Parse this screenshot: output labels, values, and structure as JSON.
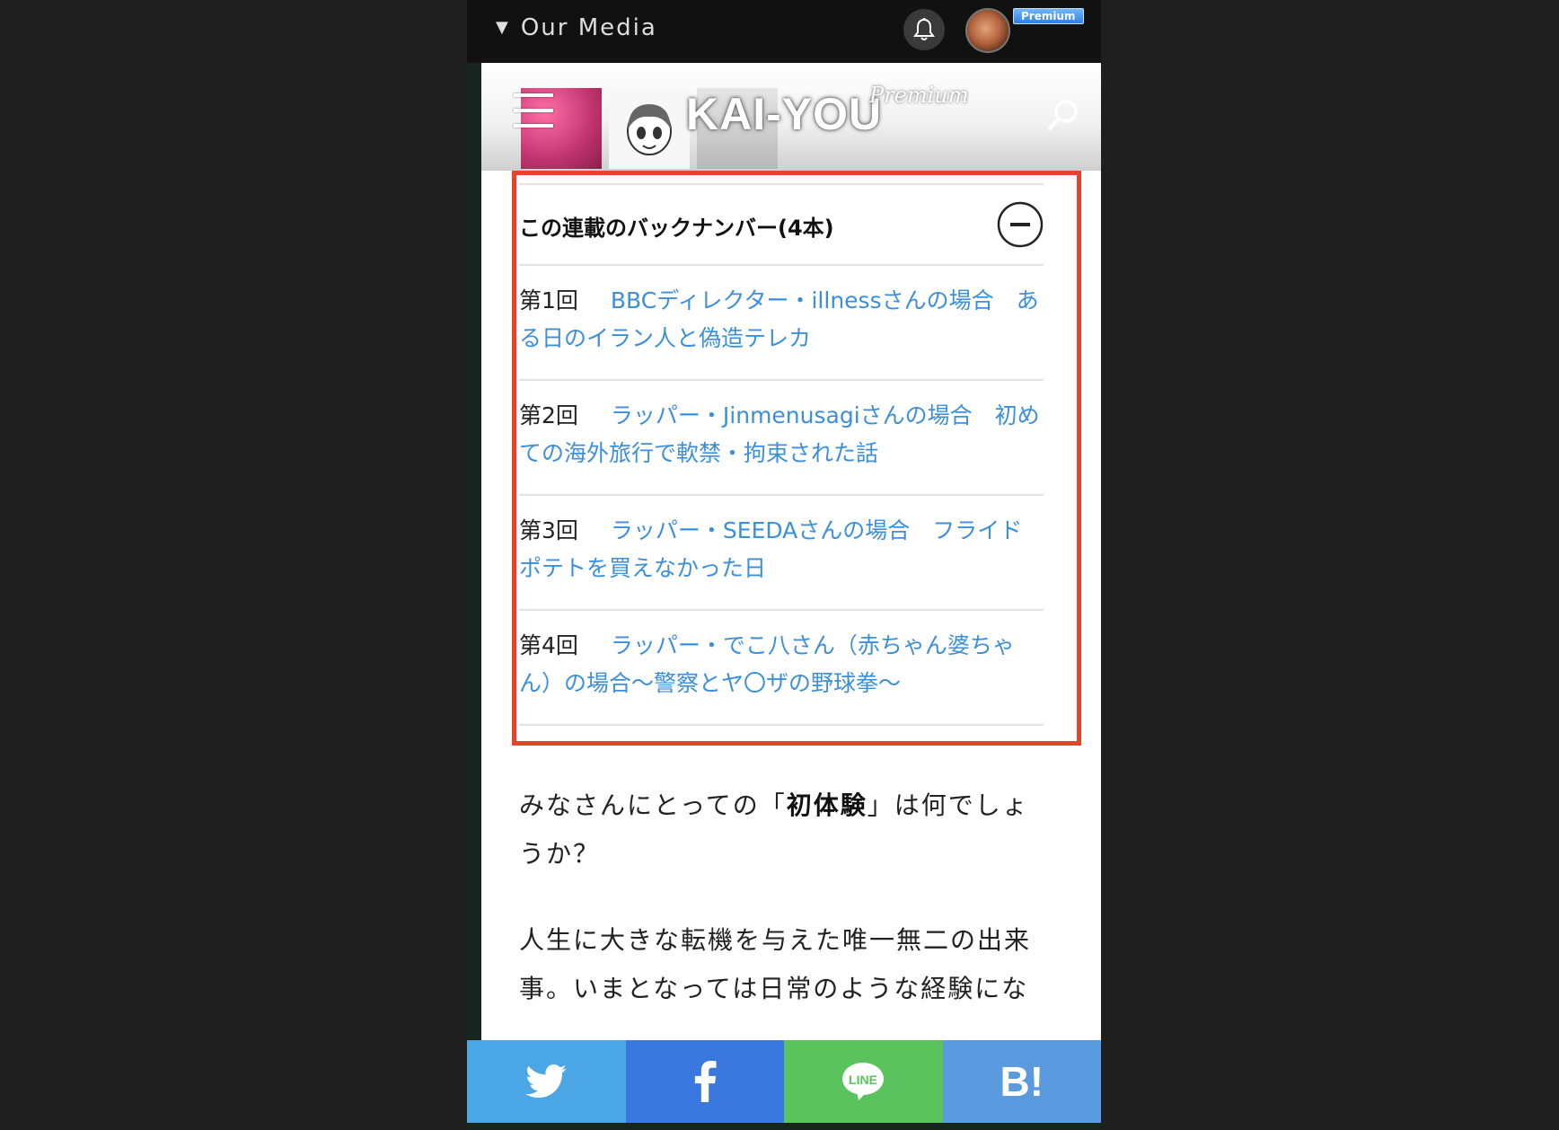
{
  "topbar": {
    "media_label": "Our Media",
    "premium_badge": "Premium"
  },
  "header": {
    "logo": "KAI-YOU",
    "logo_suffix": "Premium"
  },
  "backnumber": {
    "title": "この連載のバックナンバー(4本)",
    "episodes": [
      {
        "num": "第1回",
        "title": "BBCディレクター・illnessさんの場合　ある日のイラン人と偽造テレカ"
      },
      {
        "num": "第2回",
        "title": "ラッパー・Jinmenusagiさんの場合　初めての海外旅行で軟禁・拘束された話"
      },
      {
        "num": "第3回",
        "title": "ラッパー・SEEDAさんの場合　フライドポテトを買えなかった日"
      },
      {
        "num": "第4回",
        "title": "ラッパー・でこ八さん（赤ちゃん婆ちゃん）の場合〜警察とヤ〇ザの野球拳〜"
      }
    ]
  },
  "article": {
    "p1_before": "みなさんにとっての「",
    "p1_bold": "初体験",
    "p1_after": "」は何でしょうか？",
    "p2": "人生に大きな転機を与えた唯一無二の出来事。いまとなっては日常のような経験にな"
  },
  "share": {
    "hatena_label": "B!"
  },
  "colors": {
    "highlight": "#e8412c",
    "link": "#3b8fdb",
    "twitter": "#4aa6e5",
    "facebook": "#3a78e0",
    "line": "#5bc35e",
    "hatena": "#5a9be0"
  },
  "icons": [
    "bell-icon",
    "hamburger-icon",
    "search-icon",
    "minus-circle-icon",
    "twitter-icon",
    "facebook-icon",
    "line-icon",
    "hatena-icon"
  ]
}
